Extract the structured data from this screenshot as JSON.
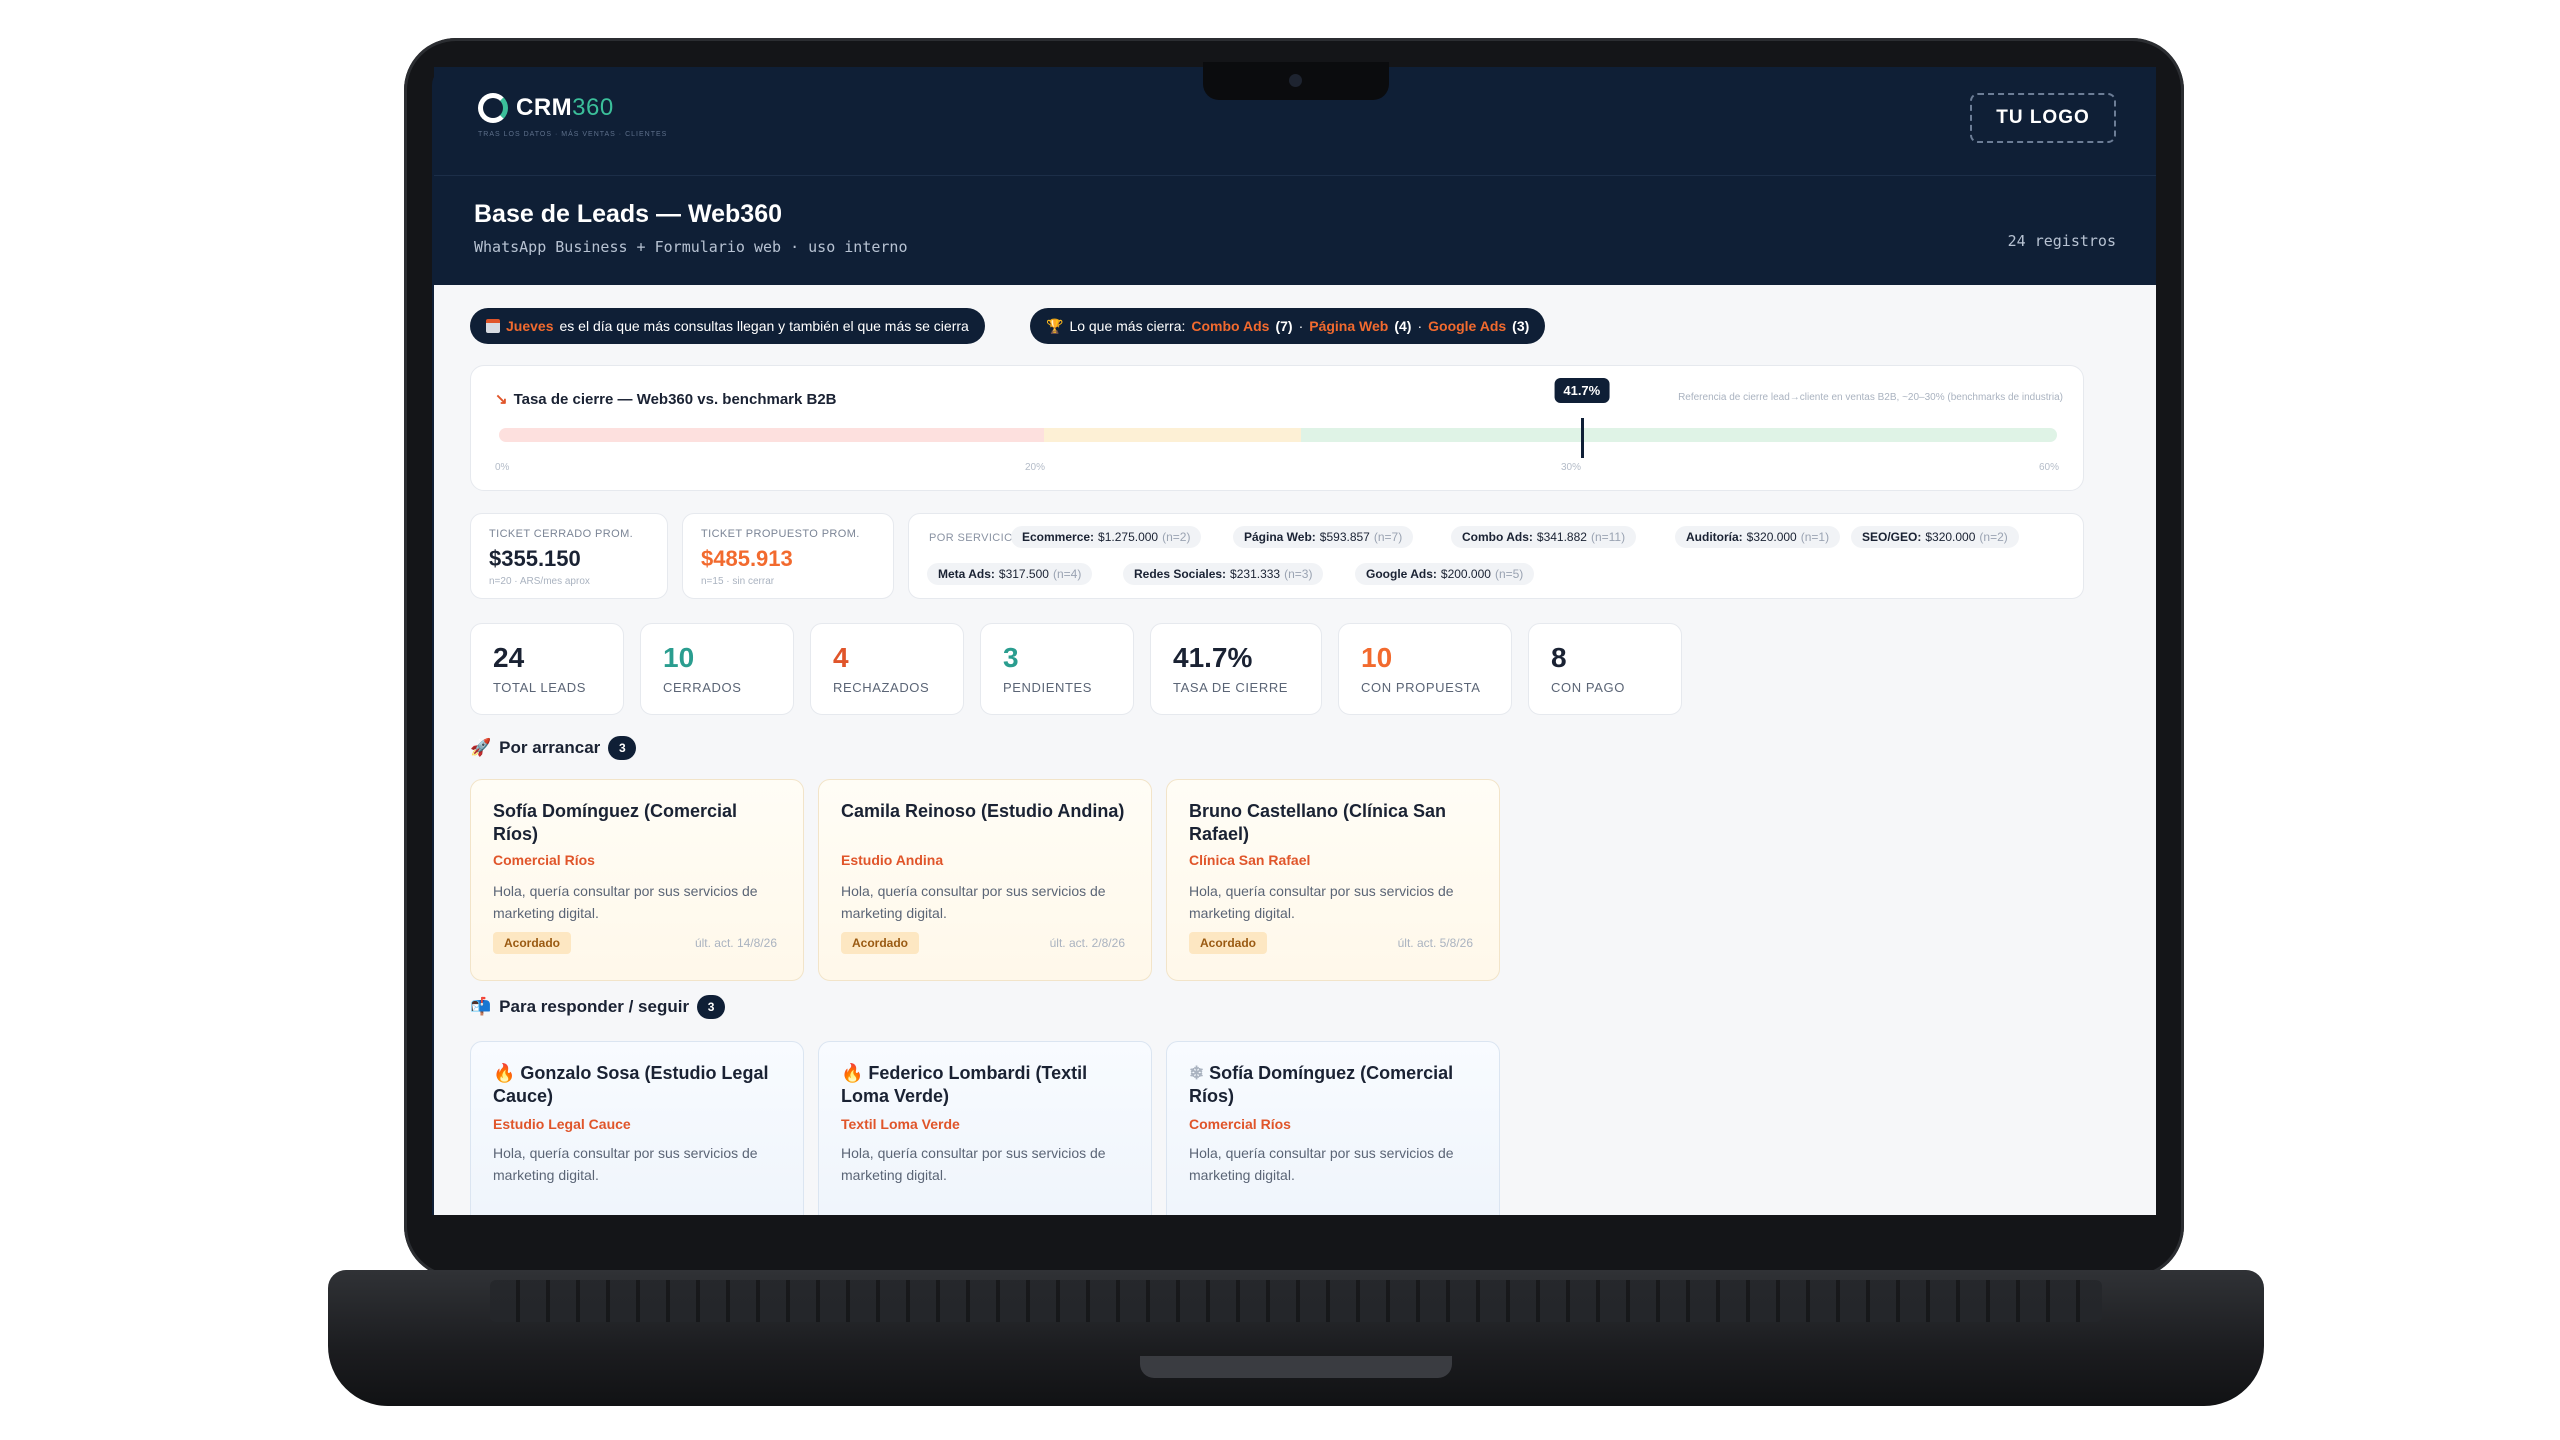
{
  "brand": {
    "name": "CRM",
    "name_accent": "360",
    "tagline": "TRAS LOS DATOS · MÁS VENTAS · CLIENTES",
    "placeholder_logo": "TU LOGO"
  },
  "header": {
    "title": "Base de Leads — Web360",
    "subtitle": "WhatsApp Business + Formulario web · uso interno",
    "records": "24 registros"
  },
  "insights": {
    "day": {
      "highlight": "Jueves",
      "text": "es el día que más consultas llegan y también el que más se cierra"
    },
    "top_closers": {
      "prefix": "Lo que más cierra:",
      "items": [
        {
          "name": "Combo Ads",
          "count": "(7)"
        },
        {
          "name": "Página Web",
          "count": "(4)"
        },
        {
          "name": "Google Ads",
          "count": "(3)"
        }
      ],
      "separator": "·"
    }
  },
  "close_rate": {
    "title": "Tasa de cierre — Web360 vs. benchmark B2B",
    "value_label": "41.7%",
    "value": 41.7,
    "scale_max": 60,
    "benchmark_note": "Referencia de cierre lead→cliente en ventas B2B, ~20–30% (benchmarks de industria)",
    "ticks": [
      "0%",
      "20%",
      "30%",
      "60%"
    ]
  },
  "tickets": [
    {
      "label": "TICKET CERRADO PROM.",
      "value": "$355.150",
      "note": "n=20 · ARS/mes aprox",
      "color": "#1a2233"
    },
    {
      "label": "TICKET PROPUESTO PROM.",
      "value": "$485.913",
      "note": "n=15 · sin cerrar",
      "color": "#f26a2e"
    }
  ],
  "services": {
    "label": "POR SERVICIO:",
    "items": [
      {
        "name": "Ecommerce:",
        "value": "$1.275.000",
        "n": "(n=2)"
      },
      {
        "name": "Página Web:",
        "value": "$593.857",
        "n": "(n=7)"
      },
      {
        "name": "Combo Ads:",
        "value": "$341.882",
        "n": "(n=11)"
      },
      {
        "name": "Auditoría:",
        "value": "$320.000",
        "n": "(n=1)"
      },
      {
        "name": "SEO/GEO:",
        "value": "$320.000",
        "n": "(n=2)"
      },
      {
        "name": "Meta Ads:",
        "value": "$317.500",
        "n": "(n=4)"
      },
      {
        "name": "Redes Sociales:",
        "value": "$231.333",
        "n": "(n=3)"
      },
      {
        "name": "Google Ads:",
        "value": "$200.000",
        "n": "(n=5)"
      }
    ]
  },
  "stats": [
    {
      "value": "24",
      "label": "TOTAL LEADS",
      "color": "#1a2233"
    },
    {
      "value": "10",
      "label": "CERRADOS",
      "color": "#2a9d8f"
    },
    {
      "value": "4",
      "label": "RECHAZADOS",
      "color": "#e0552a"
    },
    {
      "value": "3",
      "label": "PENDIENTES",
      "color": "#2a9d8f"
    },
    {
      "value": "41.7%",
      "label": "TASA DE CIERRE",
      "color": "#1a2233"
    },
    {
      "value": "10",
      "label": "CON PROPUESTA",
      "color": "#f26a2e"
    },
    {
      "value": "8",
      "label": "CON PAGO",
      "color": "#1a2233"
    }
  ],
  "sections": [
    {
      "title": "Por arrancar",
      "count": "3",
      "icon": "rocket-icon",
      "cards": [
        {
          "name": "Sofía Domínguez (Comercial Ríos)",
          "company": "Comercial Ríos",
          "message": "Hola, quería consultar por sus servicios de marketing digital.",
          "status": "Acordado",
          "date": "últ. act. 14/8/26"
        },
        {
          "name": "Camila Reinoso (Estudio Andina)",
          "company": "Estudio Andina",
          "message": "Hola, quería consultar por sus servicios de marketing digital.",
          "status": "Acordado",
          "date": "últ. act. 2/8/26"
        },
        {
          "name": "Bruno Castellano (Clínica San Rafael)",
          "company": "Clínica San Rafael",
          "message": "Hola, quería consultar por sus servicios de marketing digital.",
          "status": "Acordado",
          "date": "últ. act. 5/8/26"
        }
      ]
    },
    {
      "title": "Para responder / seguir",
      "count": "3",
      "icon": "mailbox-icon",
      "cards": [
        {
          "name": "Gonzalo Sosa (Estudio Legal Cauce)",
          "company": "Estudio Legal Cauce",
          "message": "Hola, quería consultar por sus servicios de marketing digital.",
          "icon": "fire-icon"
        },
        {
          "name": "Federico Lombardi (Textil Loma Verde)",
          "company": "Textil Loma Verde",
          "message": "Hola, quería consultar por sus servicios de marketing digital.",
          "icon": "fire-icon"
        },
        {
          "name": "Sofía Domínguez (Comercial Ríos)",
          "company": "Comercial Ríos",
          "message": "Hola, quería consultar por sus servicios de marketing digital.",
          "icon": "snowflake-icon"
        }
      ]
    }
  ]
}
